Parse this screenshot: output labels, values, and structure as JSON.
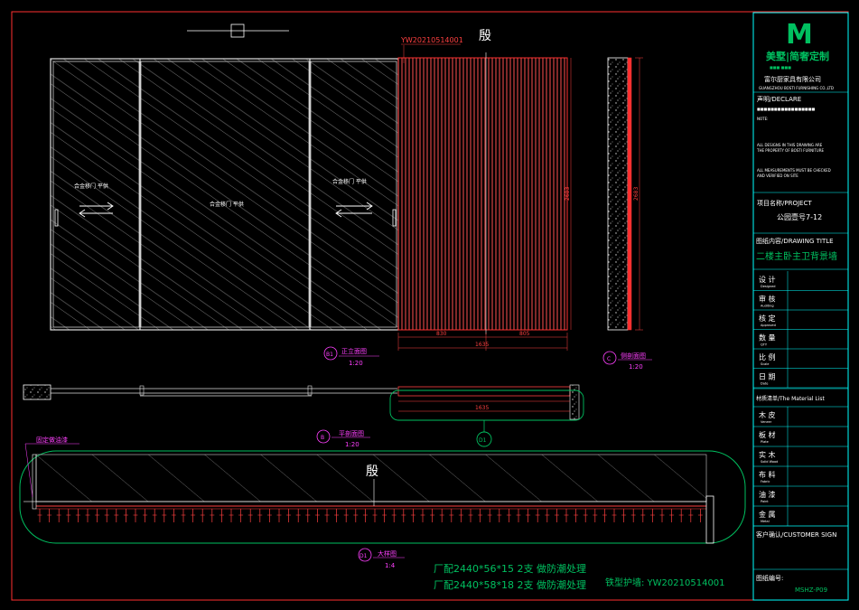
{
  "drawing": {
    "code_top": "YW20210514001",
    "sketch_char": "殷",
    "door_label": "合金移门  平供",
    "height_dim": "2683",
    "dim_left": "830",
    "dim_right": "805",
    "dim_total": "1635",
    "elev_circle": "B1",
    "elev_title": "正立面图",
    "elev_scale": "1:20",
    "side_circle": "C",
    "side_title": "侧剖面图",
    "side_scale": "1:20",
    "plan_circle": "B",
    "plan_title": "平剖面图",
    "plan_scale": "1:20",
    "plan_dim": "1635",
    "plan_tag": "D1",
    "detail_note": "固定做油漆",
    "detail_circle": "D1",
    "detail_title": "大样图",
    "detail_scale": "1:4",
    "note1": "厂配2440*56*15 2支  做防潮处理",
    "note2": "厂配2440*58*18 2支  做防潮处理",
    "note3": "铁型护墙: YW20210514001"
  },
  "title_block": {
    "logo_text": "美墅|简奢定制",
    "logo_sub": "■■■  ■■■",
    "company_cn": "富尔厨家具有限公司",
    "company_en": "GUANGZHOU BOSTI FURNISHING CO.,LTD",
    "declare": "声明/DECLARE",
    "declare_line1": "■■■■■■■■■■■■■■■■■",
    "declare_line2": "NOTE:",
    "declare_line3": "ALL DESIGNS IN THIS DRAWING ARE",
    "declare_line4": "THE PROPERTY OF BOSTI FURNITURE",
    "declare_line5": "ALL MEASUREMENTS MUST BE CHECKED",
    "declare_line6": "AND VERIFIED ON SITE",
    "project_label": "项目名称/PROJECT",
    "project_value": "公园壹号7-12",
    "drawing_label": "图纸内容/DRAWING TITLE",
    "drawing_value": "二楼主卧主卫背景墙",
    "rows1": [
      {
        "cn": "设  计",
        "en": "Designed"
      },
      {
        "cn": "审  核",
        "en": "Auditing"
      },
      {
        "cn": "核  定",
        "en": "Approved"
      },
      {
        "cn": "数  量",
        "en": "QTY"
      },
      {
        "cn": "比  例",
        "en": "Scale"
      },
      {
        "cn": "日  期",
        "en": "Date"
      }
    ],
    "material_label": "材质清单/The Material List",
    "rows2": [
      {
        "cn": "木  皮",
        "en": "Veneer"
      },
      {
        "cn": "板  材",
        "en": "Plate"
      },
      {
        "cn": "实  木",
        "en": "Solid Wood"
      },
      {
        "cn": "布  料",
        "en": "Fabric"
      },
      {
        "cn": "油  漆",
        "en": "Paint"
      },
      {
        "cn": "金  属",
        "en": "Metal"
      }
    ],
    "client_label": "客户确认/CUSTOMER SIGN",
    "drawing_no_label": "图纸编号:",
    "drawing_no_value": "MSHZ-P09"
  },
  "colors": {
    "frame": "#ff3030",
    "line": "#d8d8d8",
    "cyan": "#00ffff",
    "green": "#00c060",
    "magenta": "#ff40ff",
    "text": "#ffffff"
  }
}
